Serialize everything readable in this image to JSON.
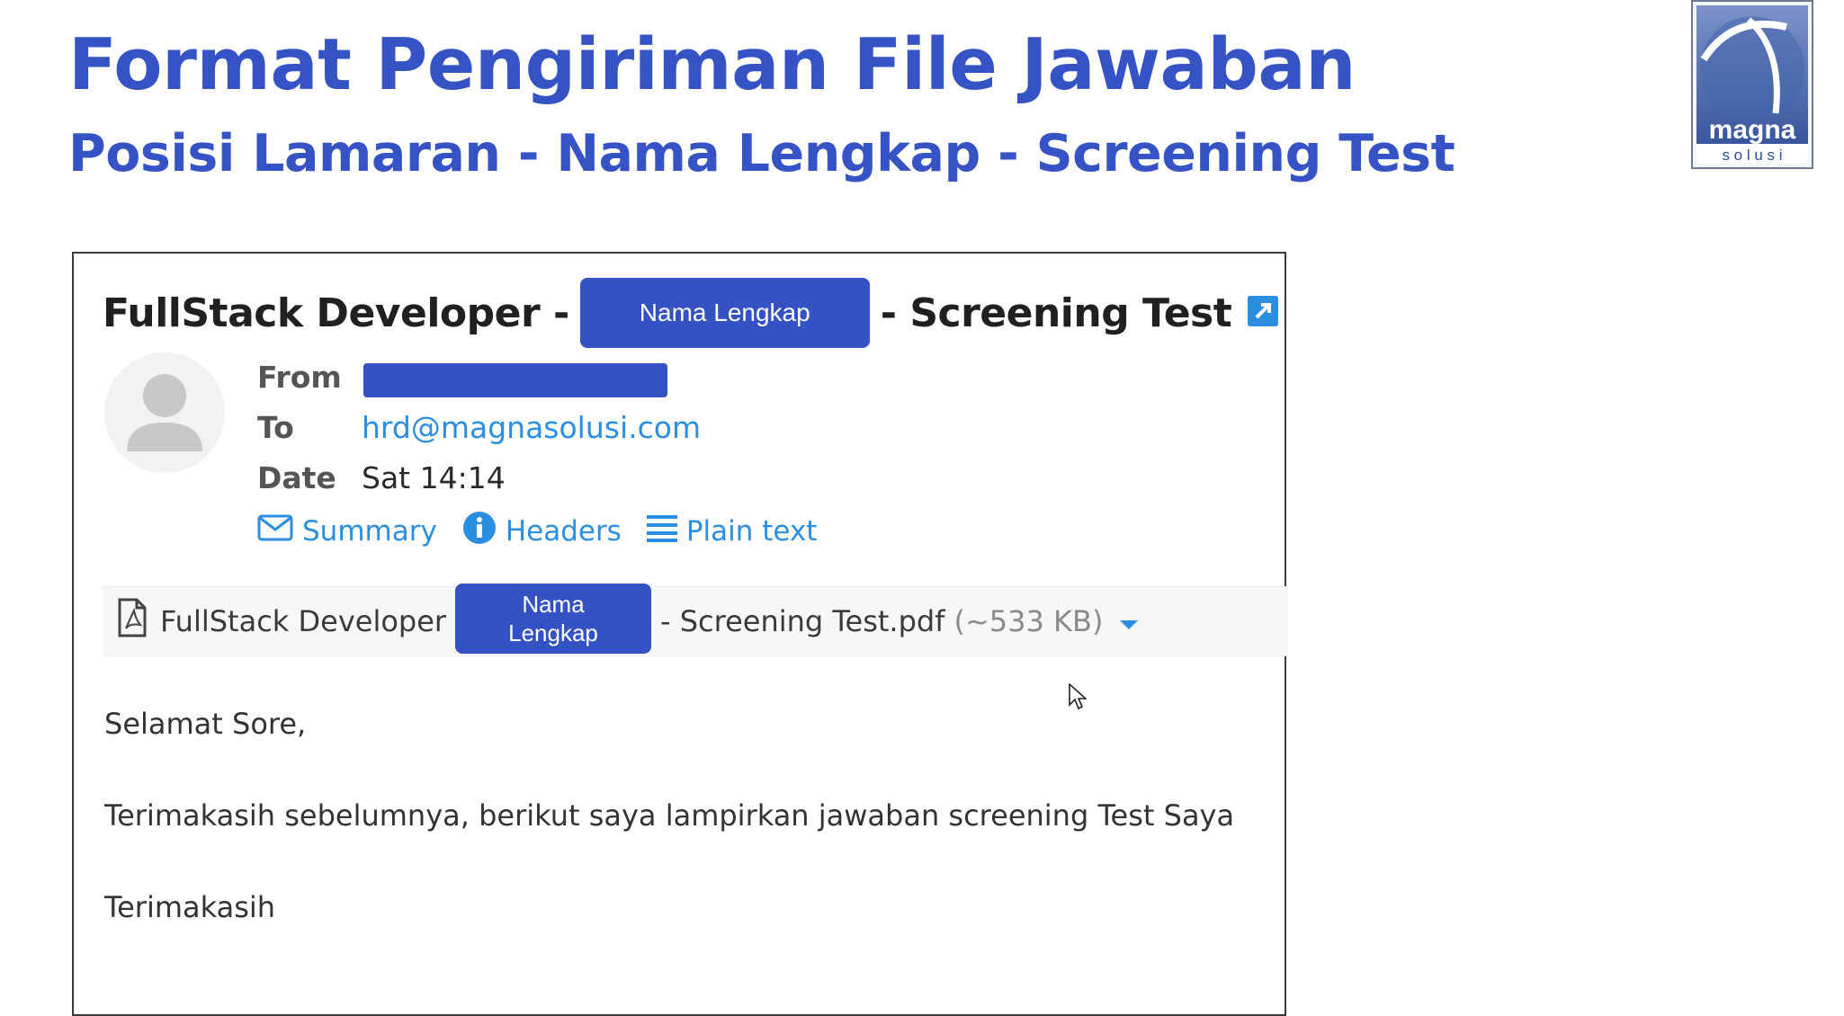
{
  "slide": {
    "title": "Format Pengiriman File Jawaban",
    "subtitle": "Posisi Lamaran - Nama Lengkap - Screening Test",
    "logo": {
      "brand": "magna",
      "tagline": "s o l u s i"
    }
  },
  "email": {
    "subject_prefix": "FullStack Developer -",
    "subject_placeholder": "Nama Lengkap",
    "subject_suffix": "- Screening Test",
    "from_label": "From",
    "to_label": "To",
    "to_value": "hrd@magnasolusi.com",
    "date_label": "Date",
    "date_value": "Sat 14:14",
    "actions": {
      "summary": "Summary",
      "headers": "Headers",
      "plain_text": "Plain text"
    },
    "attachment": {
      "prefix": "FullStack Developer -",
      "placeholder_line1": "Nama",
      "placeholder_line2": "Lengkap",
      "suffix": "- Screening Test.pdf",
      "size": "(~533 KB)"
    },
    "body": {
      "greeting": "Selamat Sore,",
      "message": "Terimakasih sebelumnya, berikut saya lampirkan jawaban screening Test Saya",
      "closing": "Terimakasih"
    }
  },
  "colors": {
    "title": "#3553c4",
    "placeholder": "#3552c4",
    "link": "#2b8ee0"
  },
  "icons": [
    "external-link-icon",
    "avatar-icon",
    "envelope-icon",
    "info-icon",
    "list-icon",
    "pdf-file-icon",
    "caret-down-icon",
    "mouse-cursor-icon"
  ]
}
